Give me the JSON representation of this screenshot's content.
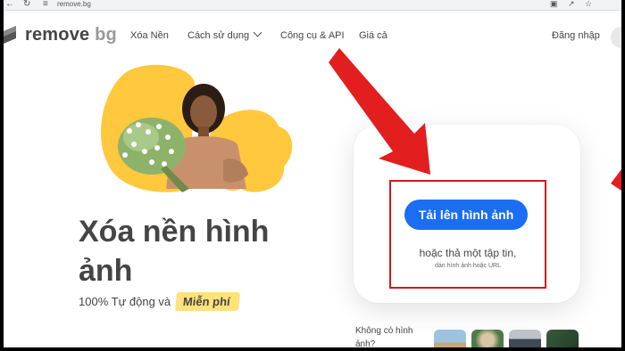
{
  "browser": {
    "url": "remove.bg"
  },
  "header": {
    "logo_main": "remove",
    "logo_suffix": "bg",
    "nav": [
      {
        "label": "Xóa Nền"
      },
      {
        "label": "Cách sử dụng"
      },
      {
        "label": "Công cụ & API"
      },
      {
        "label": "Giá cả"
      }
    ],
    "login_label": "Đăng nhập"
  },
  "hero": {
    "title": "Xóa nền hình ảnh",
    "subtitle": "100% Tự động và",
    "badge": "Miễn phí"
  },
  "upload": {
    "button_label": "Tải lên hình ảnh",
    "drop_text": "hoặc thả một tập tin,",
    "drop_subtext": "dán hình ảnh hoặc URL"
  },
  "samples": {
    "prompt": "Không có hình ảnh?"
  },
  "colors": {
    "accent": "#1b6ef3",
    "highlight": "#d0191b",
    "blob": "#ffc83d",
    "badge": "#ffe27a",
    "text": "#454545"
  }
}
